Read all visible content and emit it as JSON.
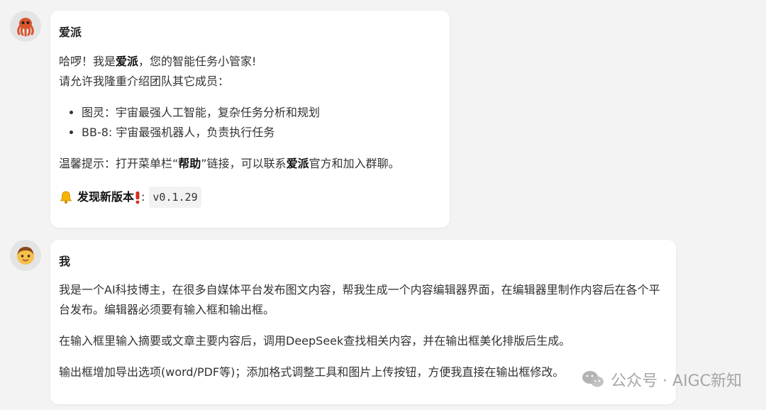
{
  "messages": [
    {
      "sender": "爱派",
      "greeting": {
        "pre": "哈啰！我是",
        "strong": "爱派",
        "post": "，您的智能任务小管家!"
      },
      "intro": "请允许我隆重介绍团队其它成员：",
      "members": [
        "图灵：宇宙最强人工智能，复杂任务分析和规划",
        "BB-8: 宇宙最强机器人，负责执行任务"
      ],
      "tip": {
        "pre": "温馨提示：打开菜单栏“",
        "strong1": "帮助",
        "mid": "”链接，可以联系",
        "strong2": "爱派",
        "post": "官方和加入群聊。"
      },
      "update": {
        "label": "发现新版本",
        "separator": ":",
        "version": "v0.1.29"
      }
    },
    {
      "sender": "我",
      "paragraphs": [
        "我是一个AI科技博主，在很多自媒体平台发布图文内容，帮我生成一个内容编辑器界面，在编辑器里制作内容后在各个平台发布。编辑器必须要有输入框和输出框。",
        "在输入框里输入摘要或文章主要内容后，调用DeepSeek查找相关内容，并在输出框美化排版后生成。",
        "输出框增加导出选项(word/PDF等)；添加格式调整工具和图片上传按钮，方便我直接在输出框修改。"
      ]
    }
  ],
  "watermark": {
    "text": "公众号 · AIGC新知"
  },
  "icons": {
    "assistant_avatar": "octopus-icon",
    "user_avatar": "boy-face-icon",
    "bell": "bell-icon",
    "exclamation": "exclamation-icon",
    "wechat": "wechat-icon"
  }
}
